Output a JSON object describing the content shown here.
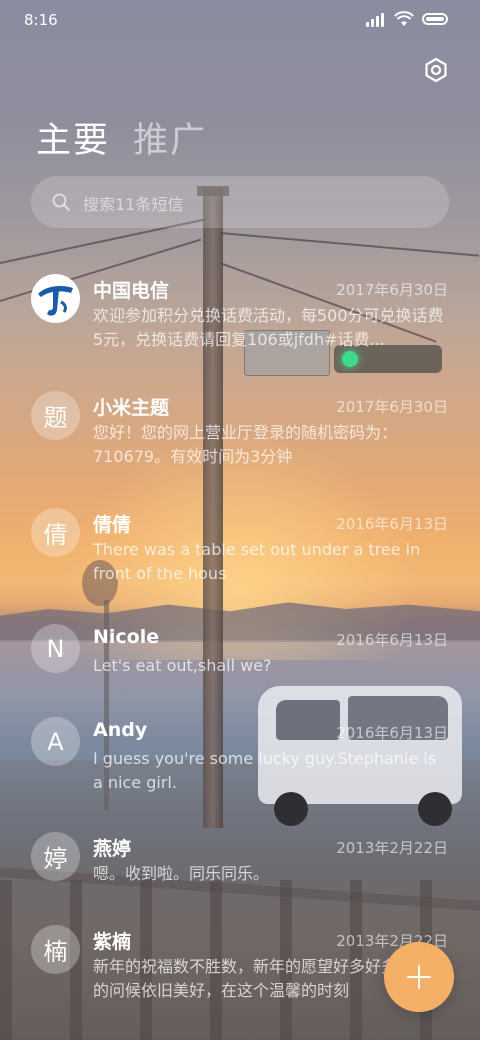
{
  "status_bar": {
    "time": "8:16"
  },
  "tabs": [
    {
      "label": "主要",
      "active": true
    },
    {
      "label": "推广",
      "active": false
    }
  ],
  "search": {
    "placeholder": "搜索11条短信"
  },
  "conversations": [
    {
      "name": "中国电信",
      "date": "2017年6月30日",
      "avatar": "telecom-logo",
      "preview": "欢迎参加积分兑换话费活动，每500分可兑换话费5元，兑换话费请回复106或jfdh#话费..."
    },
    {
      "name": "小米主题",
      "date": "2017年6月30日",
      "avatar": "题",
      "preview": "您好！您的网上营业厅登录的随机密码为：710679。有效时间为3分钟"
    },
    {
      "name": "倩倩",
      "date": "2016年6月13日",
      "avatar": "倩",
      "preview": "There was a table set out under a tree in front of the hous"
    },
    {
      "name": "Nicole",
      "date": "2016年6月13日",
      "avatar": "N",
      "preview": "Let's eat out,shall we?"
    },
    {
      "name": "Andy",
      "date": "2016年6月13日",
      "avatar": "A",
      "preview": "I guess you're some lucky guy.Stephanie is a nice girl."
    },
    {
      "name": "燕婷",
      "date": "2013年2月22日",
      "avatar": "婷",
      "preview": "嗯。收到啦。同乐同乐。"
    },
    {
      "name": "紫楠",
      "date": "2013年2月22日",
      "avatar": "楠",
      "preview": "新年的祝福数不胜数，新年的愿望好多好多，新年的问候依旧美好，在这个温馨的时刻"
    }
  ],
  "colors": {
    "fab": "#f5b067",
    "telecom_blue": "#1a5aa8"
  },
  "icons": {
    "settings": "hexagon-settings-icon",
    "search": "search-icon",
    "fab": "plus-icon"
  }
}
